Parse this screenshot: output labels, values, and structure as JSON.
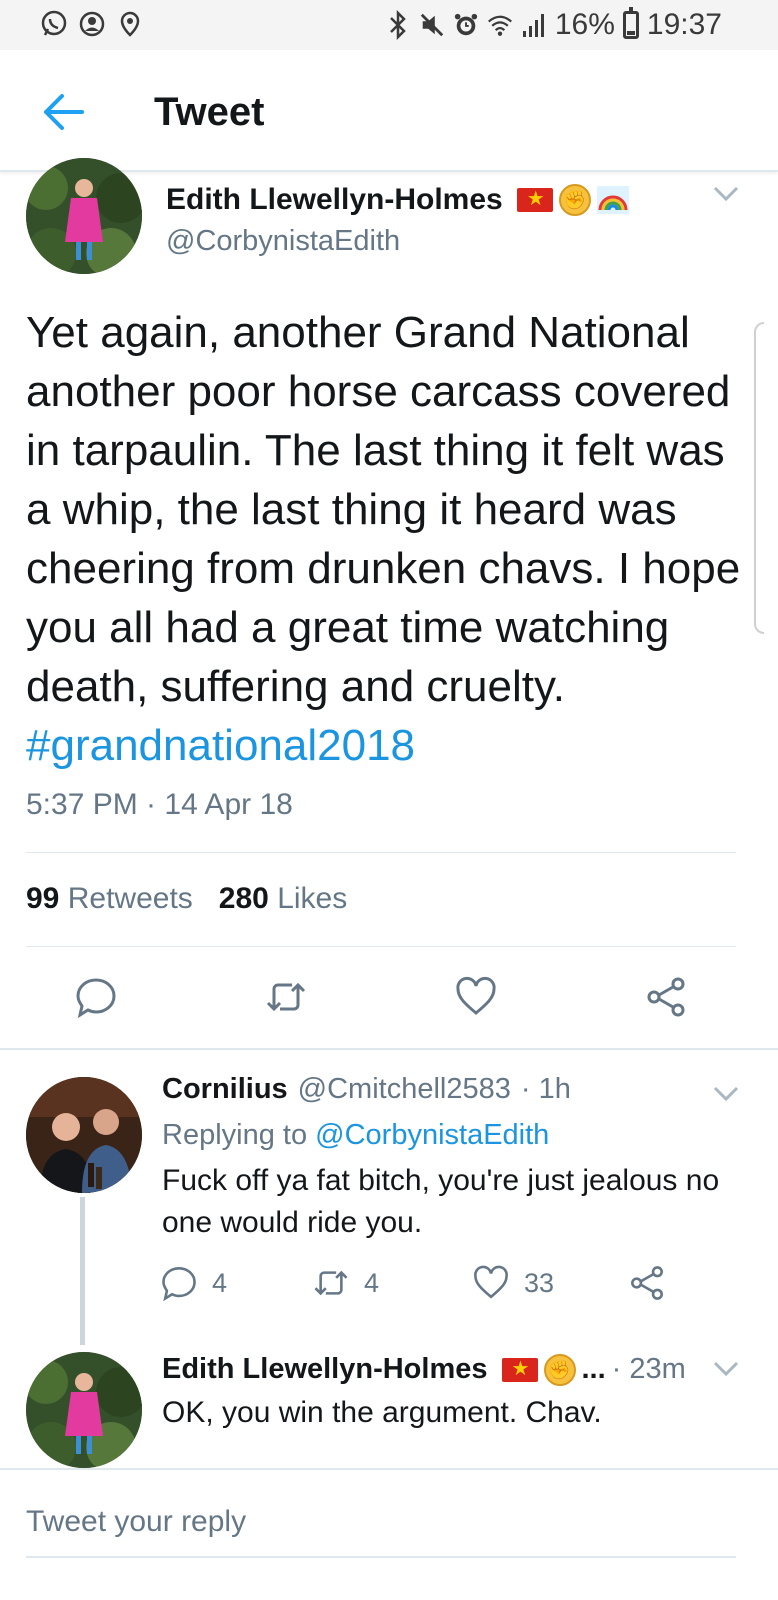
{
  "status_bar": {
    "left_icons": [
      "whatsapp-icon",
      "account-icon",
      "location-icon"
    ],
    "right_icons": [
      "bluetooth-icon",
      "mute-icon",
      "alarm-icon",
      "wifi-icon",
      "signal-icon"
    ],
    "battery_level": 0.16,
    "battery_text": "16%",
    "time": "19:37"
  },
  "header": {
    "title": "Tweet",
    "back_icon": "back-arrow-icon"
  },
  "colors": {
    "link": "#1b95e0",
    "muted": "#657786",
    "text": "#14171a",
    "divider": "#e1e8ed"
  },
  "main_tweet": {
    "author_name": "Edith Llewellyn-Holmes",
    "author_handle": "@CorbynistaEdith",
    "text": "Yet again, another Grand National another poor horse carcass covered in tarpaulin. The last thing it felt was a whip, the last thing it heard was cheering from drunken chavs. I hope you all had a great time watching death, suffering and cruelty. ",
    "hashtag": "#grandnational2018",
    "time": "5:37 PM · 14 Apr 18",
    "retweets_count": "99",
    "retweets_label": "Retweets",
    "likes_count": "280",
    "likes_label": "Likes"
  },
  "replies": [
    {
      "author_name": "Cornilius",
      "author_handle": "@Cmitchell2583",
      "age": "· 1h",
      "replying_prefix": "Replying to",
      "replying_to": "@CorbynistaEdith",
      "text": "Fuck off ya fat bitch, you're just jealous no one would ride you.",
      "reply_count": "4",
      "retweet_count": "4",
      "like_count": "33"
    },
    {
      "author_name": "Edith Llewellyn-Holmes",
      "ellipsis": "...",
      "age": "· 23m",
      "text": "OK, you win the argument. Chav."
    }
  ],
  "composer": {
    "placeholder": "Tweet your reply"
  }
}
